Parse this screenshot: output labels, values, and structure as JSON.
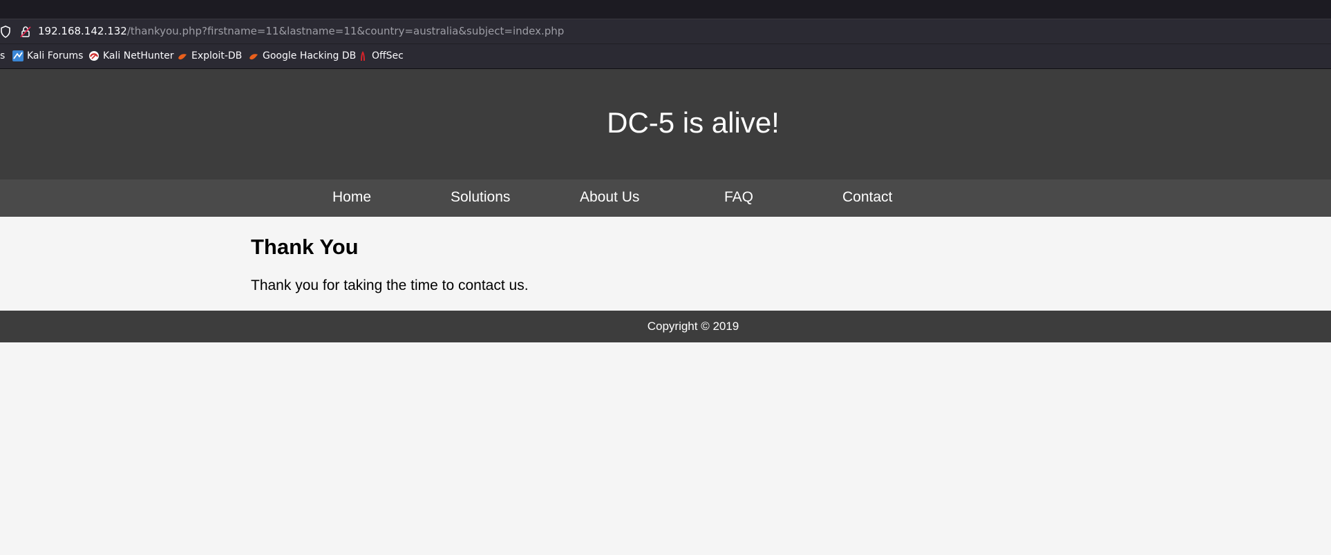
{
  "browser": {
    "url_host": "192.168.142.132",
    "url_path": "/thankyou.php?firstname=11&lastname=11&country=australia&subject=index.php",
    "bookmarks": [
      {
        "label": "s",
        "icon": "bookmark-edge-icon"
      },
      {
        "label": "Kali Forums",
        "icon": "kali-forums-icon"
      },
      {
        "label": "Kali NetHunter",
        "icon": "kali-nethunter-icon"
      },
      {
        "label": "Exploit-DB",
        "icon": "exploit-db-icon"
      },
      {
        "label": "Google Hacking DB",
        "icon": "google-hacking-db-icon"
      },
      {
        "label": "OffSec",
        "icon": "offsec-icon"
      }
    ]
  },
  "site": {
    "title": "DC-5 is alive!",
    "nav": [
      "Home",
      "Solutions",
      "About Us",
      "FAQ",
      "Contact"
    ],
    "heading": "Thank You",
    "message": "Thank you for taking the time to contact us.",
    "footer": "Copyright © 2019"
  },
  "colors": {
    "header_bg": "#3d3d3d",
    "nav_bg": "#4a4a4a",
    "page_bg": "#f5f5f5",
    "browser_chrome": "#2b2a33"
  }
}
